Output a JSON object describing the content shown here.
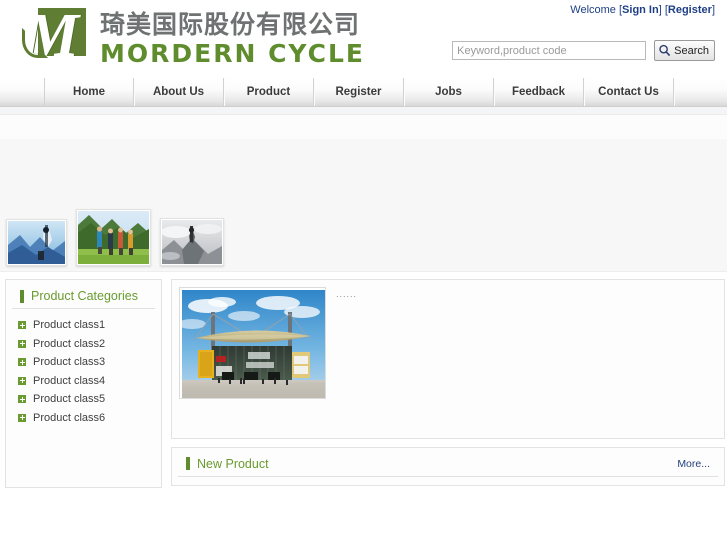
{
  "header": {
    "logo": {
      "mark_letter": "M",
      "company_cn": "琦美国际股份有限公司",
      "company_en": "MORDERN CYCLE"
    },
    "welcome_prefix": "Welcome ",
    "sign_in_bracket_open": "[",
    "sign_in": "Sign In",
    "sign_in_bracket_close": "]",
    "register_bracket_open": " [",
    "register": "Register",
    "register_bracket_close": "]",
    "search": {
      "placeholder": "Keyword,product code",
      "value": "",
      "button_label": "Search",
      "icon": "search-icon"
    }
  },
  "nav": {
    "items": [
      {
        "label": "Home"
      },
      {
        "label": "About Us"
      },
      {
        "label": "Product"
      },
      {
        "label": "Register"
      },
      {
        "label": "Jobs"
      },
      {
        "label": "Feedback"
      },
      {
        "label": "Contact Us"
      }
    ]
  },
  "gallery": {
    "thumbs": [
      {
        "alt": "climber-winter-blue-thumbnail"
      },
      {
        "alt": "hikers-green-mountain-thumbnail"
      },
      {
        "alt": "summit-grayscale-thumbnail"
      }
    ]
  },
  "sidebar": {
    "title": "Product Categories",
    "categories": [
      {
        "label": "Product class1"
      },
      {
        "label": "Product class2"
      },
      {
        "label": "Product class3"
      },
      {
        "label": "Product class4"
      },
      {
        "label": "Product class5"
      },
      {
        "label": "Product class6"
      }
    ]
  },
  "promo": {
    "image_alt": "exhibition-hall-building-photo",
    "caption_dots": "......"
  },
  "new_product": {
    "title": "New Product",
    "more_label": "More..."
  },
  "colors": {
    "brand_green": "#5f8d2e",
    "heading_green": "#6a9b30",
    "link_blue": "#24407f",
    "logo_gray": "#6e7272",
    "nav_text": "#3a3a3a"
  }
}
